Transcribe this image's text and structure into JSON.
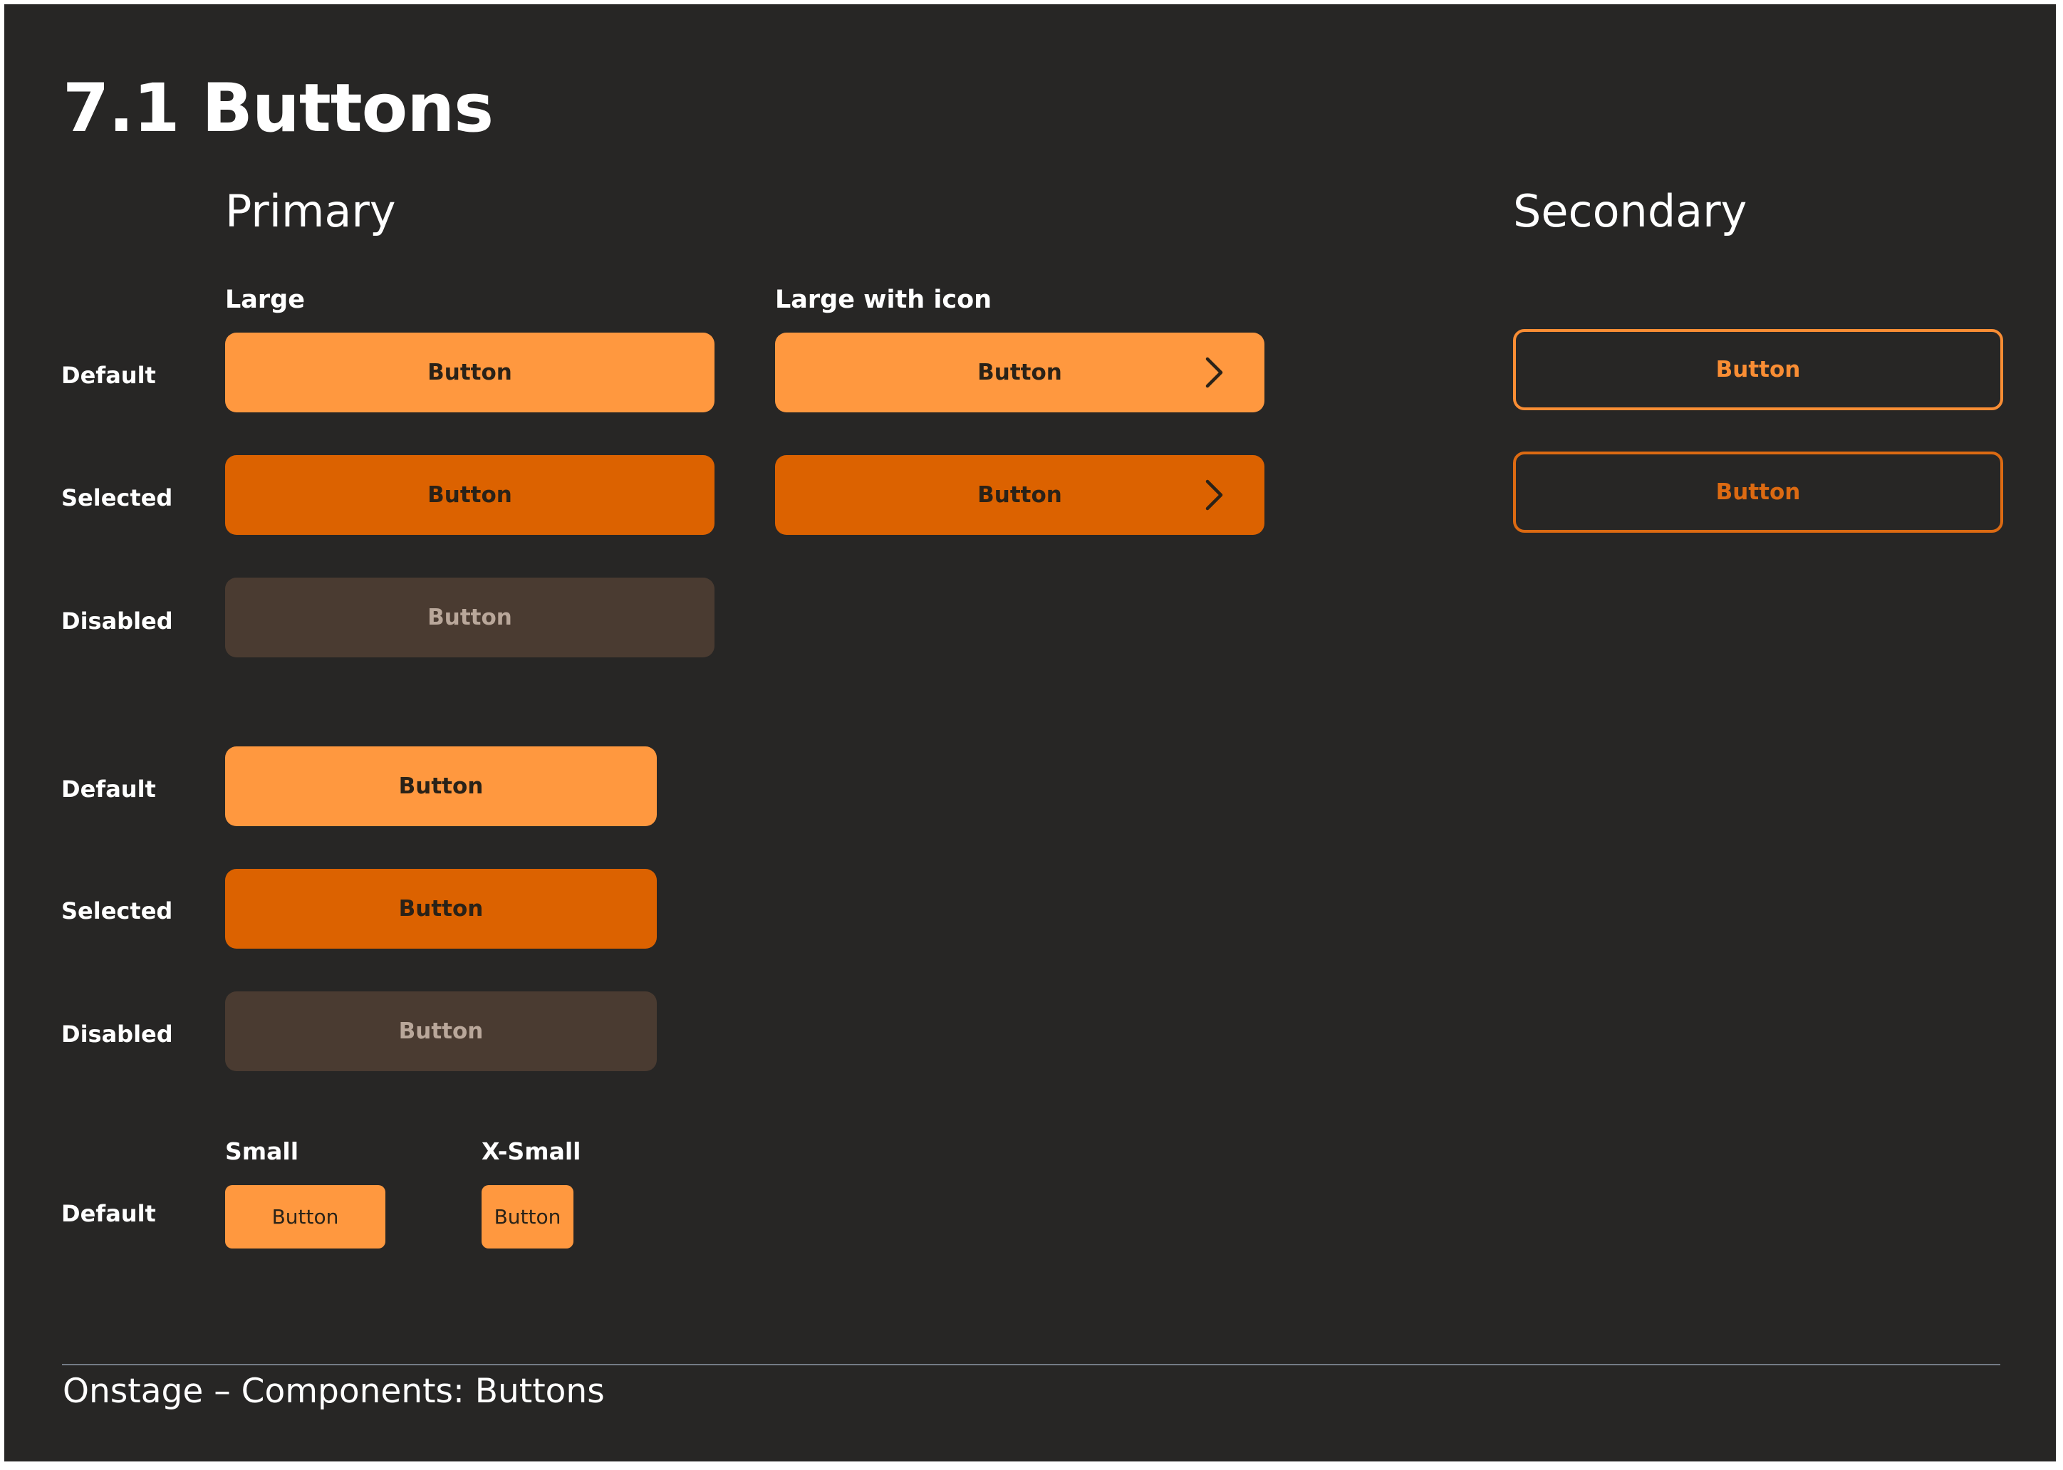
{
  "page": {
    "title": "7.1 Buttons",
    "footer": "Onstage – Components: Buttons"
  },
  "colors": {
    "background": "#272625",
    "primary_default": "#ff983f",
    "primary_selected": "#dc6200",
    "primary_disabled": "#4a3b31",
    "secondary_border": "#f98d34",
    "secondary_selected_border": "#dc6a12",
    "footer_rule": "#737b86"
  },
  "primary": {
    "title": "Primary",
    "large_label": "Large",
    "large_icon_label": "Large with icon",
    "small_label": "Small",
    "xsmall_label": "X-Small",
    "states": {
      "default": "Default",
      "selected": "Selected",
      "disabled": "Disabled"
    },
    "button_label": "Button",
    "icon": "chevron-right-icon"
  },
  "secondary": {
    "title": "Secondary",
    "button_label": "Button"
  }
}
